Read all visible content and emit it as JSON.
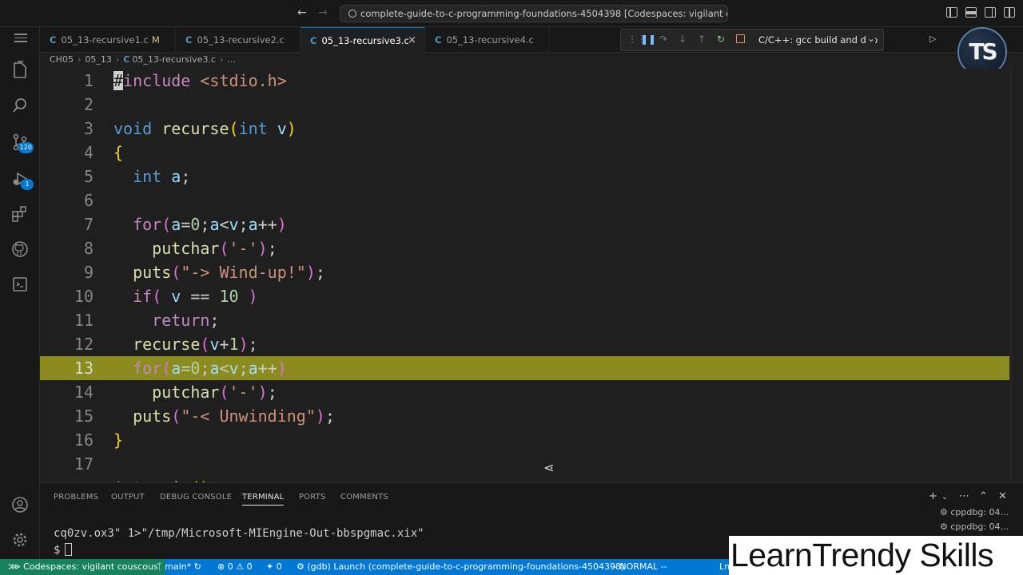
{
  "window": {
    "command_center": "complete-guide-to-c-programming-foundations-4504398 [Codespaces: vigilant couscous]"
  },
  "tabs": [
    {
      "label": "05_13-recursive1.c",
      "modified": "M"
    },
    {
      "label": "05_13-recursive2.c"
    },
    {
      "label": "05_13-recursive3.c",
      "close": "×"
    },
    {
      "label": "05_13-recursive4.c"
    }
  ],
  "debug": {
    "config": "C/C++: gcc build and debug active file"
  },
  "activity": {
    "scm_badge": "120",
    "debug_badge": "1"
  },
  "logo": {
    "text": "TS"
  },
  "breadcrumb": [
    "CH05",
    "05_13",
    "05_13-recursive3.c",
    "..."
  ],
  "editor": {
    "line_numbers": [
      "1",
      "2",
      "3",
      "4",
      "5",
      "6",
      "7",
      "8",
      "9",
      "10",
      "11",
      "12",
      "13",
      "14",
      "15",
      "16",
      "17"
    ],
    "current_line": "13"
  },
  "panel": {
    "tabs": [
      "PROBLEMS",
      "OUTPUT",
      "DEBUG CONSOLE",
      "TERMINAL",
      "PORTS",
      "COMMENTS"
    ],
    "active_tab": "TERMINAL",
    "terminal_lines": [
      "cq0zv.ox3\" 1>\"/tmp/Microsoft-MIEngine-Out-bbspgmac.xix\"",
      "$"
    ],
    "instances": [
      "cppdbg: 04...",
      "cppdbg: 04..."
    ]
  },
  "status": {
    "remote": "Codespaces: vigilant couscous",
    "branch": "main*",
    "problems": "0",
    "warnings": "0",
    "ports": "0",
    "launch": "(gdb) Launch (complete-guide-to-c-programming-foundations-4504398)",
    "mode": "-- NORMAL --",
    "position": "Ln"
  },
  "watermark": "LearnTrendy Skills"
}
